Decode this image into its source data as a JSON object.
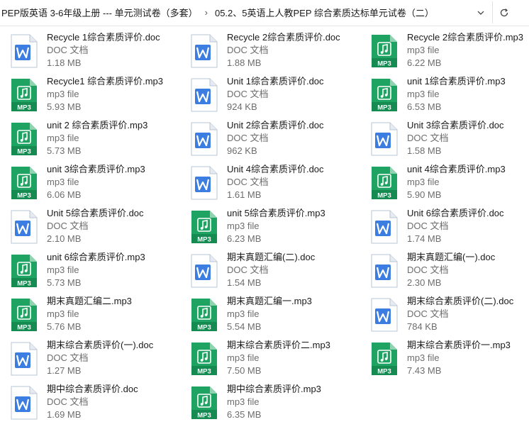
{
  "address": {
    "segments": [
      "PEP版英语 3-6年级上册 --- 单元测试卷（多套）",
      "05.2、5英语上人教PEP 综合素质达标单元试卷（二）"
    ],
    "separator": "›",
    "dropdown_icon": "chevron-down-icon",
    "refresh_icon": "refresh-icon"
  },
  "colors": {
    "doc_blue": "#3b7de0",
    "mp3_green": "#1ea362"
  },
  "files": [
    {
      "name": "Recycle 1综合素质评价.doc",
      "type": "DOC 文档",
      "size": "1.18 MB",
      "kind": "doc"
    },
    {
      "name": "Recycle 2综合素质评价.doc",
      "type": "DOC 文档",
      "size": "1.88 MB",
      "kind": "doc"
    },
    {
      "name": "Recycle 2综合素质评价.mp3",
      "type": "mp3 file",
      "size": "6.22 MB",
      "kind": "mp3",
      "badge": "MP3"
    },
    {
      "name": "Recycle1 综合素质评价.mp3",
      "type": "mp3 file",
      "size": "5.93 MB",
      "kind": "mp3",
      "badge": "MP3"
    },
    {
      "name": "Unit 1综合素质评价.doc",
      "type": "DOC 文档",
      "size": "924 KB",
      "kind": "doc"
    },
    {
      "name": "unit 1综合素质评价.mp3",
      "type": "mp3 file",
      "size": "6.53 MB",
      "kind": "mp3",
      "badge": "MP3"
    },
    {
      "name": "unit 2 综合素质评价.mp3",
      "type": "mp3 file",
      "size": "5.73 MB",
      "kind": "mp3",
      "badge": "MP3"
    },
    {
      "name": "Unit 2综合素质评价.doc",
      "type": "DOC 文档",
      "size": "962 KB",
      "kind": "doc"
    },
    {
      "name": "Unit 3综合素质评价.doc",
      "type": "DOC 文档",
      "size": "1.58 MB",
      "kind": "doc"
    },
    {
      "name": "unit 3综合素质评价.mp3",
      "type": "mp3 file",
      "size": "6.06 MB",
      "kind": "mp3",
      "badge": "MP3"
    },
    {
      "name": "Unit 4综合素质评价.doc",
      "type": "DOC 文档",
      "size": "1.61 MB",
      "kind": "doc"
    },
    {
      "name": "unit 4综合素质评价.mp3",
      "type": "mp3 file",
      "size": "5.90 MB",
      "kind": "mp3",
      "badge": "MP3"
    },
    {
      "name": "Unit 5综合素质评价.doc",
      "type": "DOC 文档",
      "size": "2.10 MB",
      "kind": "doc"
    },
    {
      "name": "unit 5综合素质评价.mp3",
      "type": "mp3 file",
      "size": "6.23 MB",
      "kind": "mp3",
      "badge": "MP3"
    },
    {
      "name": "Unit 6综合素质评价.doc",
      "type": "DOC 文档",
      "size": "1.74 MB",
      "kind": "doc"
    },
    {
      "name": "unit 6综合素质评价.mp3",
      "type": "mp3 file",
      "size": "5.73 MB",
      "kind": "mp3",
      "badge": "MP3"
    },
    {
      "name": "期末真题汇编(二).doc",
      "type": "DOC 文档",
      "size": "1.54 MB",
      "kind": "doc"
    },
    {
      "name": "期末真题汇编(一).doc",
      "type": "DOC 文档",
      "size": "2.30 MB",
      "kind": "doc"
    },
    {
      "name": "期末真题汇编二.mp3",
      "type": "mp3 file",
      "size": "5.76 MB",
      "kind": "mp3",
      "badge": "MP3"
    },
    {
      "name": "期末真题汇编一.mp3",
      "type": "mp3 file",
      "size": "5.54 MB",
      "kind": "mp3",
      "badge": "MP3"
    },
    {
      "name": "期末综合素质评价(二).doc",
      "type": "DOC 文档",
      "size": "784 KB",
      "kind": "doc"
    },
    {
      "name": "期末综合素质评价(一).doc",
      "type": "DOC 文档",
      "size": "1.27 MB",
      "kind": "doc"
    },
    {
      "name": "期末综合素质评价二.mp3",
      "type": "mp3 file",
      "size": "7.50 MB",
      "kind": "mp3",
      "badge": "MP3"
    },
    {
      "name": "期末综合素质评价一.mp3",
      "type": "mp3 file",
      "size": "7.43 MB",
      "kind": "mp3",
      "badge": "MP3"
    },
    {
      "name": "期中综合素质评价.doc",
      "type": "DOC 文档",
      "size": "1.69 MB",
      "kind": "doc"
    },
    {
      "name": "期中综合素质评价.mp3",
      "type": "mp3 file",
      "size": "6.35 MB",
      "kind": "mp3",
      "badge": "MP3"
    }
  ]
}
